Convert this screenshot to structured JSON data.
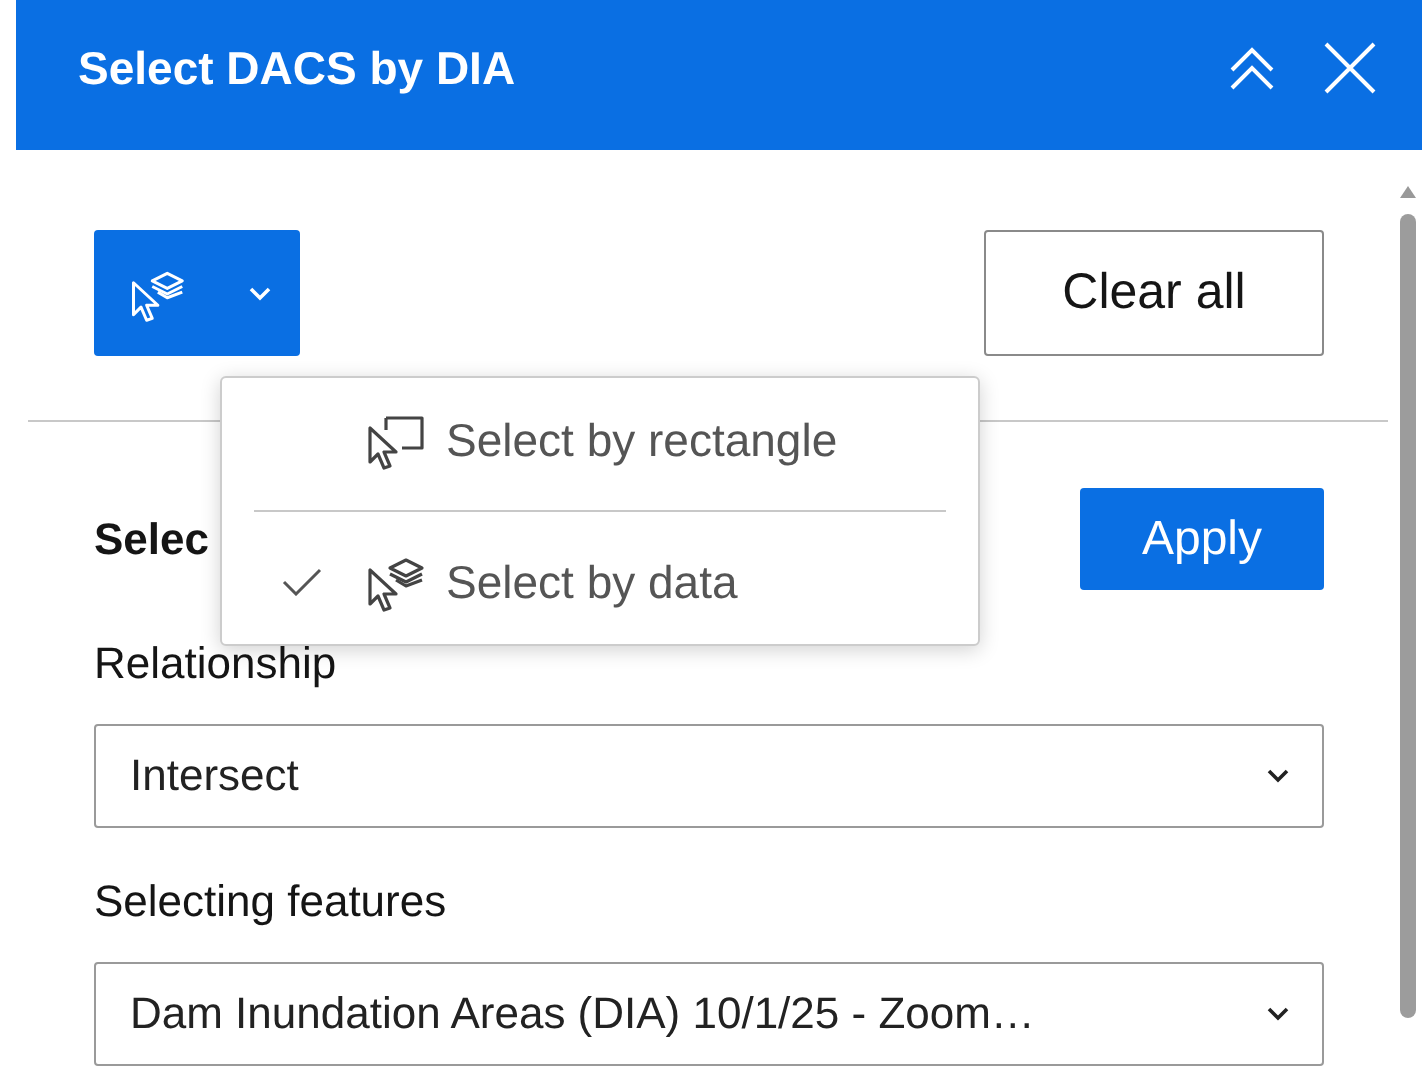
{
  "window": {
    "title": "Select DACS by DIA"
  },
  "toolbar": {
    "clear_button": "Clear all"
  },
  "select_menu": {
    "open": true,
    "items": [
      {
        "label": "Select by rectangle",
        "kind": "rectangle",
        "selected": false
      },
      {
        "label": "Select by data",
        "kind": "data",
        "selected": true
      }
    ]
  },
  "section": {
    "title": "Selec",
    "apply_button": "Apply"
  },
  "fields": [
    {
      "label": "Relationship",
      "value": "Intersect"
    },
    {
      "label": "Selecting features",
      "value": "Dam Inundation Areas (DIA) 10/1/25 - Zoom…"
    }
  ]
}
